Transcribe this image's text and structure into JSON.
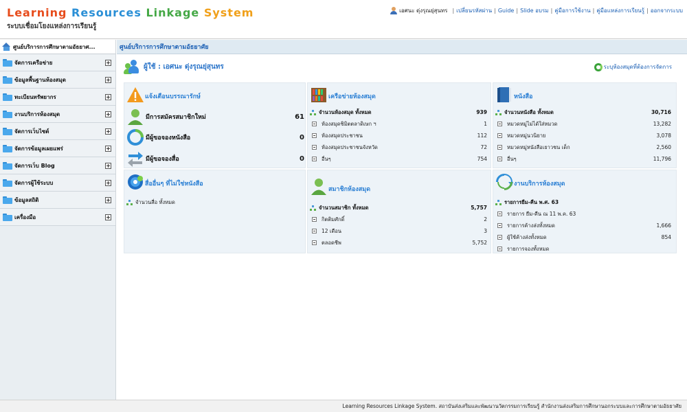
{
  "header": {
    "logo_words": [
      {
        "text": "Learning",
        "color": "#e74c1c"
      },
      {
        "text": "Resources",
        "color": "#2a8fd6"
      },
      {
        "text": "Linkage",
        "color": "#44a845"
      },
      {
        "text": "System",
        "color": "#f0a01a"
      }
    ],
    "logo_sub": "ระบบเชื่อมโยงแหล่งการเรียนรู้",
    "user_name": "เอศนะ ดุ่งรุณยุ่สุนทร",
    "links": [
      "เปลี่ยนรหัสผ่าน",
      "Guide",
      "Slide อบรม",
      "คู่มือการใช้งาน",
      "คู่มือแหล่งการเรียนรู้",
      "ออกจากระบบ"
    ]
  },
  "sidebar": {
    "title": "ศูนย์บริการการศึกษาตามอัธยาศ...",
    "items": [
      {
        "label": "จัดการเครือข่าย"
      },
      {
        "label": "ข้อมูลพื้นฐานห้องสมุด"
      },
      {
        "label": "ทะเบียนทรัพยากร"
      },
      {
        "label": "งานบริการห้องสมุด"
      },
      {
        "label": "จัดการเว็บไซต์"
      },
      {
        "label": "จัดการข้อมูลเผยแพร่"
      },
      {
        "label": "จัดการเว็บ Blog"
      },
      {
        "label": "จัดการผู้ใช้ระบบ"
      },
      {
        "label": "ข้อมูลสถิติ"
      },
      {
        "label": "เครื่องมือ"
      }
    ]
  },
  "main": {
    "title": "ศูนย์บริการการศึกษาตามอัธยาศัย",
    "user_label": "ผู้ใช้ : เอศนะ ดุ่งรุณยุ่สุนทร",
    "choose_library": "ระบุห้องสมุดที่ต้องการจัดการ",
    "alerts": {
      "title": "แจ้งเตือนบรรณารักษ์",
      "rows": [
        {
          "label": "มีการสมัครสมาชิกใหม่",
          "value": "61"
        },
        {
          "label": "มีผู้ขอจองหนังสือ",
          "value": "0"
        },
        {
          "label": "มีผู้ขอจองสื่อ",
          "value": "0"
        }
      ]
    },
    "network": {
      "title": "เครือข่ายห้องสมุด",
      "total_label": "จำนวนห้องสมุด ทั้งหมด",
      "total_value": "939",
      "rows": [
        {
          "label": "ห้องสมุดชิมิตตลาดิเษก ฯ",
          "value": "1"
        },
        {
          "label": "ห้องสมุดประชาชน",
          "value": "112"
        },
        {
          "label": "ห้องสมุดประชาชนจังหวัด",
          "value": "72"
        },
        {
          "label": "อื่นๆ",
          "value": "754"
        }
      ]
    },
    "books": {
      "title": "หนังสือ",
      "total_label": "จำนวนหนังสือ ทั้งหมด",
      "total_value": "30,716",
      "rows": [
        {
          "label": "หมวดหมู่ไม่ได้ใส่หมวด",
          "value": "13,282"
        },
        {
          "label": "หมวดหมู่นวนิยาย",
          "value": "3,078"
        },
        {
          "label": "หมวดหมู่หนังสือเยาวชน เด็ก",
          "value": "2,560"
        },
        {
          "label": "อื่นๆ",
          "value": "11,796"
        }
      ]
    },
    "media": {
      "title": "สื่ออื่นๆ ที่ไม่ใช่หนังสือ",
      "total_label": "จำนวนสื่อ ทั้งหมด"
    },
    "members": {
      "title": "สมาชิกห้องสมุด",
      "total_label": "จำนวนสมาชิก ทั้งหมด",
      "total_value": "5,757",
      "rows": [
        {
          "label": "กิตติมศักดิ์",
          "value": "2"
        },
        {
          "label": "12 เดือน",
          "value": "3"
        },
        {
          "label": "ตลอดชีพ",
          "value": "5,752"
        }
      ]
    },
    "services": {
      "title": "งานบริการห้องสมุด",
      "total_label": "รายการยืม-คืน พ.ศ. 63",
      "rows": [
        {
          "label": "รายการ ยืม-คืน ณ 11 พ.ค. 63",
          "value": ""
        },
        {
          "label": "รายการค้างส่งทั้งหมด",
          "value": "1,666"
        },
        {
          "label": "ผู้ใช้ค้างส่งทั้งหมด",
          "value": "854"
        },
        {
          "label": "รายการจองทั้งหมด",
          "value": ""
        }
      ]
    }
  },
  "footer": {
    "text": "Learning Resources Linkage System. สถาบันส่งเสริมและพัฒนานวัตกรรมการเรียนรู้ สำนักงานส่งเสริมการศึกษานอกระบบและการศึกษาตามอัธยาศัย"
  }
}
